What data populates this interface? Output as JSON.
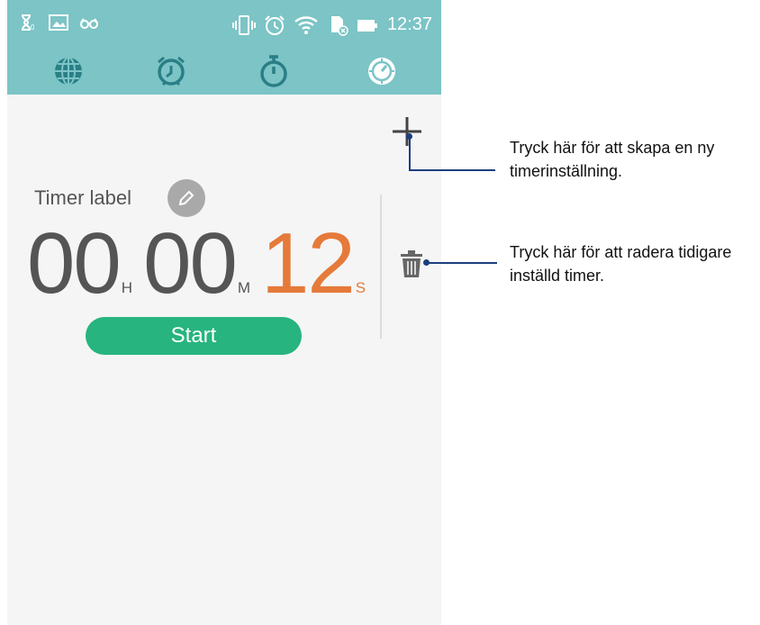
{
  "status_bar": {
    "time": "12:37",
    "icons": [
      "hourglass-icon",
      "image-icon",
      "glasses-icon",
      "vibrate-icon",
      "alarm-icon",
      "wifi-icon",
      "sd-card-icon",
      "battery-icon"
    ]
  },
  "tabs": [
    {
      "name": "world-clock-tab",
      "icon": "globe-icon"
    },
    {
      "name": "alarm-tab",
      "icon": "alarm-clock-icon"
    },
    {
      "name": "stopwatch-tab",
      "icon": "stopwatch-icon"
    },
    {
      "name": "timer-tab",
      "icon": "timer-icon"
    }
  ],
  "timer": {
    "label": "Timer label",
    "hours": "00",
    "hours_unit": "H",
    "minutes": "00",
    "minutes_unit": "M",
    "seconds": "12",
    "seconds_unit": "S",
    "start_label": "Start"
  },
  "annotations": {
    "add_line1": "Tryck här för att skapa en ny",
    "add_line2": "timerinställning.",
    "delete_line1": "Tryck här för att radera tidigare",
    "delete_line2": "inställd timer."
  },
  "colors": {
    "header": "#7cc4c6",
    "accent_seconds": "#e57a3a",
    "start_button": "#27b47f",
    "callout": "#1c3f7f"
  }
}
